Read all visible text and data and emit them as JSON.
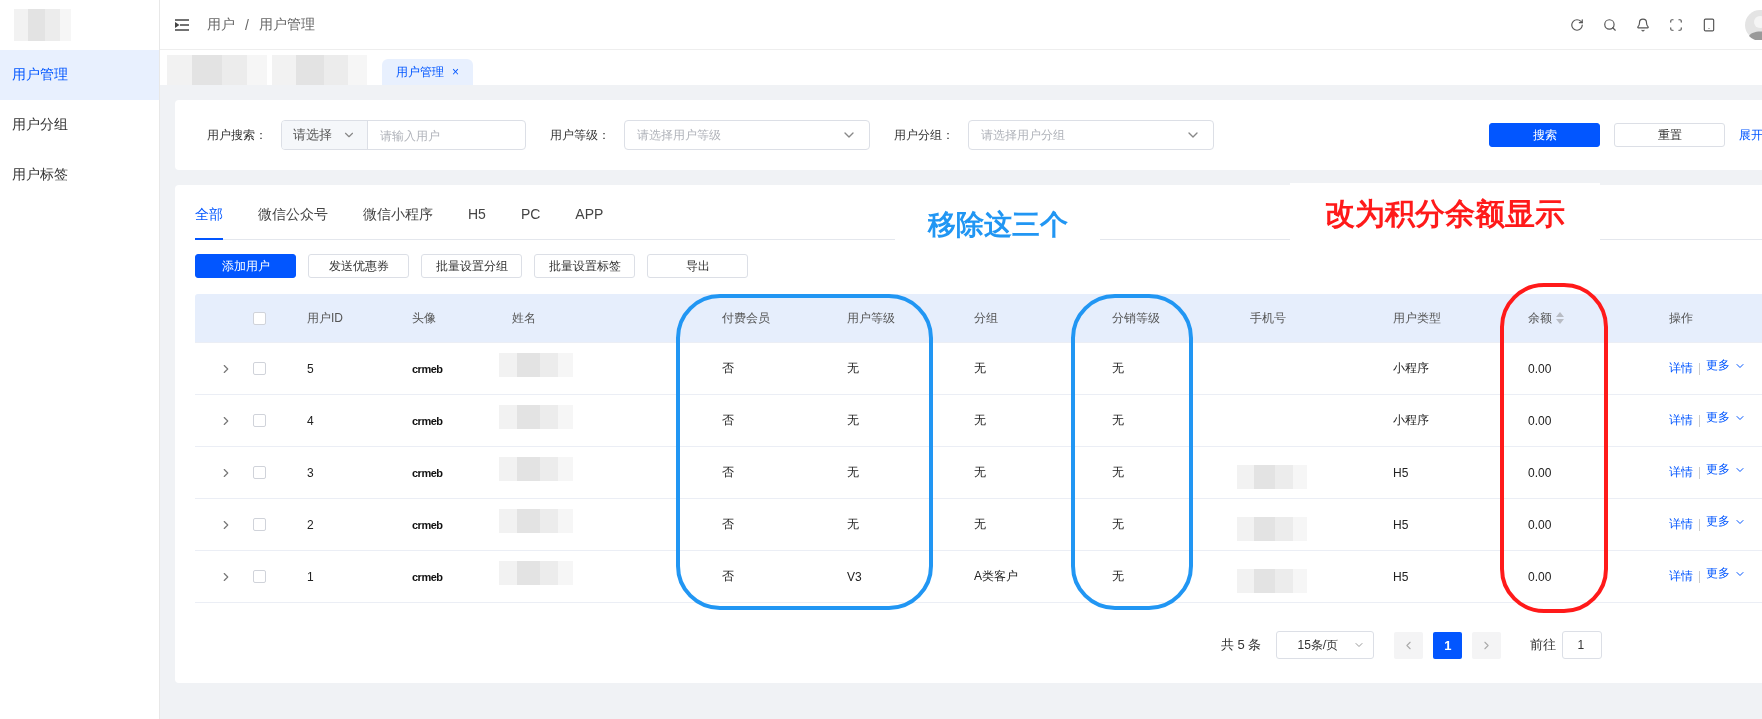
{
  "sidebar": {
    "items": [
      {
        "label": "用户管理",
        "selected": true
      },
      {
        "label": "用户分组",
        "selected": false
      },
      {
        "label": "用户标签",
        "selected": false
      }
    ]
  },
  "header": {
    "breadcrumb": [
      "用户",
      "用户管理"
    ],
    "separator": "/"
  },
  "page_tabs": [
    {
      "label": "用户管理",
      "selected": true,
      "close": "×"
    }
  ],
  "filters": {
    "fields": [
      {
        "label": "用户搜索：",
        "kind": "search",
        "select": "请选择",
        "placeholder": "请输入用户"
      },
      {
        "label": "用户等级：",
        "kind": "select",
        "placeholder": "请选择用户等级"
      },
      {
        "label": "用户分组：",
        "kind": "select",
        "placeholder": "请选择用户分组"
      }
    ],
    "buttons": [
      {
        "label": "搜索",
        "kind": "primary"
      },
      {
        "label": "重置",
        "kind": "plain"
      }
    ],
    "expand": "展开"
  },
  "channel_tabs": [
    {
      "label": "全部",
      "selected": true
    },
    {
      "label": "微信公众号",
      "selected": false
    },
    {
      "label": "微信小程序",
      "selected": false
    },
    {
      "label": "H5",
      "selected": false
    },
    {
      "label": "PC",
      "selected": false
    },
    {
      "label": "APP",
      "selected": false
    }
  ],
  "actions": [
    {
      "label": "添加用户",
      "kind": "primary"
    },
    {
      "label": "发送优惠券",
      "kind": "plain"
    },
    {
      "label": "批量设置分组",
      "kind": "plain"
    },
    {
      "label": "批量设置标签",
      "kind": "plain"
    },
    {
      "label": "导出",
      "kind": "plain"
    }
  ],
  "table": {
    "header_checked": false,
    "columns": [
      {
        "label": "用户ID",
        "sortable": false
      },
      {
        "label": "头像",
        "sortable": false
      },
      {
        "label": "姓名",
        "sortable": false
      },
      {
        "label": "付费会员",
        "sortable": false
      },
      {
        "label": "用户等级",
        "sortable": false
      },
      {
        "label": "分组",
        "sortable": false
      },
      {
        "label": "分销等级",
        "sortable": false
      },
      {
        "label": "手机号",
        "sortable": false
      },
      {
        "label": "用户类型",
        "sortable": false
      },
      {
        "label": "余额",
        "sortable": true
      },
      {
        "label": "操作",
        "sortable": false
      }
    ],
    "rows": [
      {
        "expanded": false,
        "checked": false,
        "id": "5",
        "avatar": "crmeb",
        "paid": "否",
        "level": "无",
        "group": "无",
        "dist_level": "无",
        "phone_blurred": false,
        "type": "小程序",
        "balance": "0.00",
        "actions": [
          "详情",
          "更多"
        ]
      },
      {
        "expanded": false,
        "checked": false,
        "id": "4",
        "avatar": "crmeb",
        "paid": "否",
        "level": "无",
        "group": "无",
        "dist_level": "无",
        "phone_blurred": false,
        "type": "小程序",
        "balance": "0.00",
        "actions": [
          "详情",
          "更多"
        ]
      },
      {
        "expanded": false,
        "checked": false,
        "id": "3",
        "avatar": "crmeb",
        "paid": "否",
        "level": "无",
        "group": "无",
        "dist_level": "无",
        "phone_blurred": true,
        "type": "H5",
        "balance": "0.00",
        "actions": [
          "详情",
          "更多"
        ]
      },
      {
        "expanded": false,
        "checked": false,
        "id": "2",
        "avatar": "crmeb",
        "paid": "否",
        "level": "无",
        "group": "无",
        "dist_level": "无",
        "phone_blurred": true,
        "type": "H5",
        "balance": "0.00",
        "actions": [
          "详情",
          "更多"
        ]
      },
      {
        "expanded": false,
        "checked": false,
        "id": "1",
        "avatar": "crmeb",
        "paid": "否",
        "level": "V3",
        "group": "A类客户",
        "dist_level": "无",
        "phone_blurred": true,
        "type": "H5",
        "balance": "0.00",
        "actions": [
          "详情",
          "更多"
        ]
      }
    ]
  },
  "pagination": {
    "total": "共 5 条",
    "page_size": "15条/页",
    "pages": [
      {
        "label": "1",
        "selected": true
      }
    ],
    "goto_label": "前往",
    "goto_value": "1"
  },
  "annotations": [
    {
      "text": "移除这三个",
      "color": "#2196f3"
    },
    {
      "text": "改为积分余额显示",
      "color": "#ff1a1a"
    }
  ]
}
